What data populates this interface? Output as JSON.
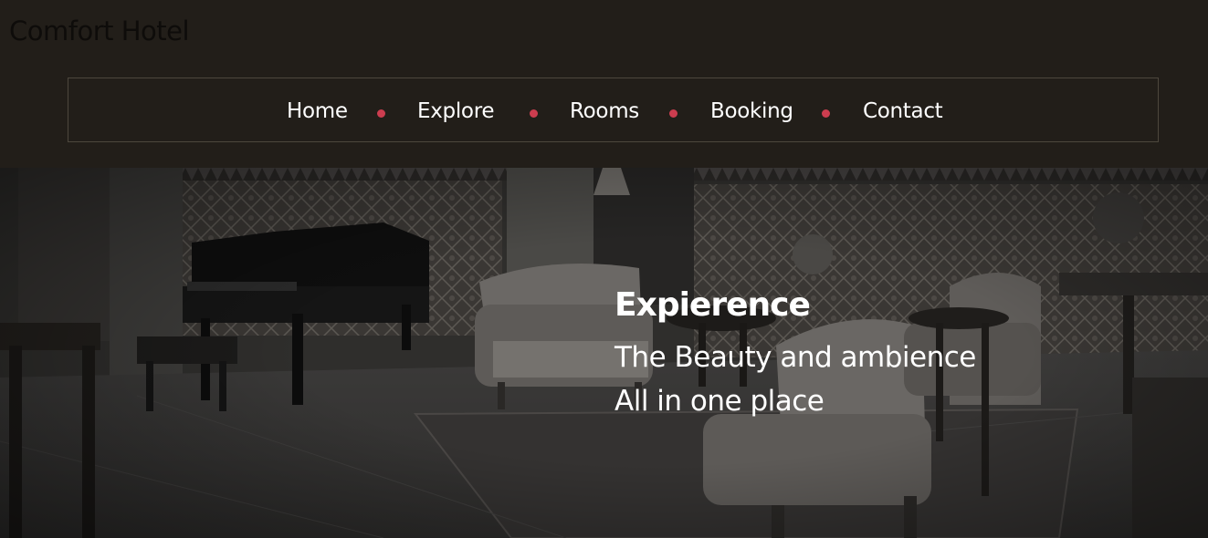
{
  "site": {
    "title": "Comfort Hotel"
  },
  "nav": {
    "items": [
      "Home",
      "Explore",
      "Rooms",
      "Booking",
      "Contact"
    ]
  },
  "hero": {
    "headline": "Expierence",
    "line1": "The Beauty and ambience",
    "line2": "All in one place"
  },
  "colors": {
    "header_bg": "#221e19",
    "nav_dot": "#cc3d4f",
    "nav_border": "#4d473d",
    "text": "#ffffff"
  }
}
